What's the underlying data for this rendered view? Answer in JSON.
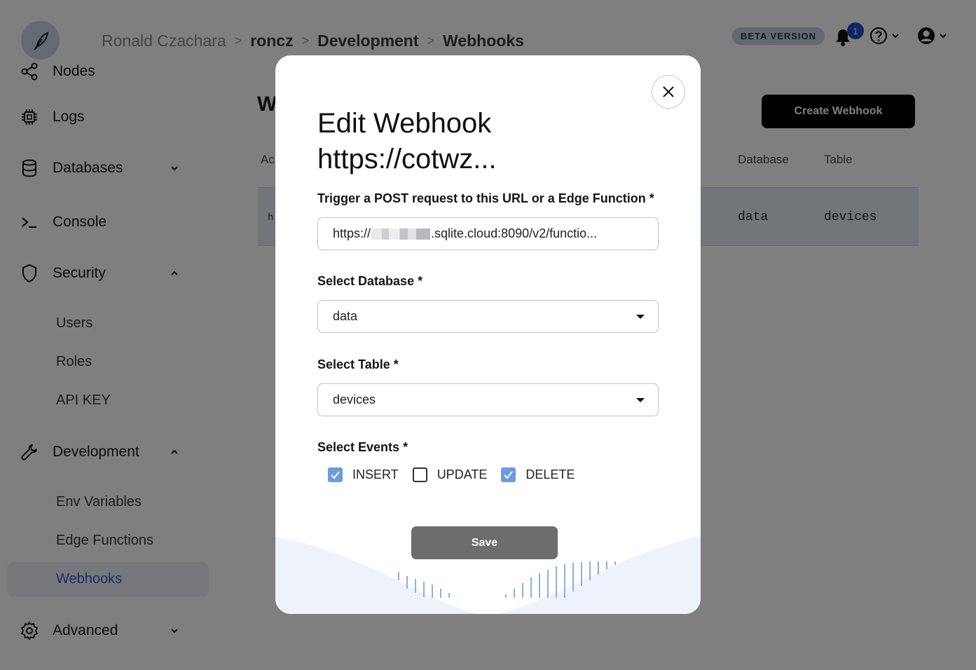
{
  "breadcrumb": {
    "items": [
      "Ronald Czachara",
      "roncz",
      "Development",
      "Webhooks"
    ]
  },
  "header": {
    "beta_label": "BETA VERSION",
    "notification_count": "1"
  },
  "sidebar": {
    "items": [
      {
        "label": "Nodes"
      },
      {
        "label": "Logs"
      },
      {
        "label": "Databases"
      },
      {
        "label": "Console"
      },
      {
        "label": "Security"
      },
      {
        "label": "Development"
      },
      {
        "label": "Advanced"
      }
    ],
    "security_sub": [
      "Users",
      "Roles",
      "API KEY"
    ],
    "development_sub": [
      "Env Variables",
      "Edge Functions",
      "Webhooks"
    ],
    "active_item": "Webhooks",
    "accent_color": "#2a5bd7"
  },
  "main": {
    "title": "W",
    "create_button": "Create Webhook",
    "table": {
      "headers": {
        "action": "Ac",
        "database": "Database",
        "table": "Table"
      },
      "rows": [
        {
          "action": "h",
          "database": "data",
          "table": "devices"
        }
      ]
    }
  },
  "modal": {
    "title_line1": "Edit Webhook",
    "title_line2": "https://cotwz...",
    "url_label": "Trigger a POST request to this URL or a Edge Function *",
    "url_prefix": "https://",
    "url_suffix": ".sqlite.cloud:8090/v2/functio...",
    "database_label": "Select Database *",
    "database_value": "data",
    "table_label": "Select Table *",
    "table_value": "devices",
    "events_label": "Select Events *",
    "events": [
      {
        "label": "INSERT",
        "checked": true
      },
      {
        "label": "UPDATE",
        "checked": false
      },
      {
        "label": "DELETE",
        "checked": true
      }
    ],
    "save_label": "Save"
  }
}
